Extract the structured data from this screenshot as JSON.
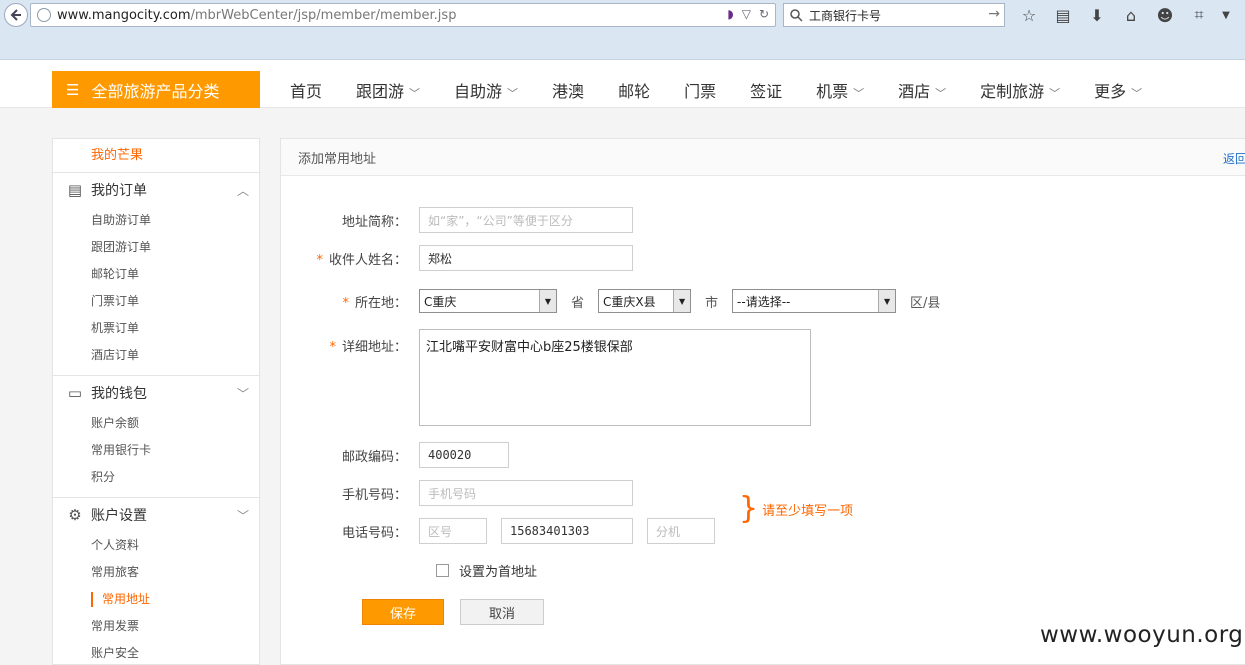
{
  "browser": {
    "url_domain": "www.mangocity.com",
    "url_path": "/mbrWebCenter/jsp/member/member.jsp",
    "search_text": "工商银行卡号"
  },
  "nav": {
    "category_label": "全部旅游产品分类",
    "items": [
      {
        "label": "首页",
        "dropdown": false
      },
      {
        "label": "跟团游",
        "dropdown": true
      },
      {
        "label": "自助游",
        "dropdown": true
      },
      {
        "label": "港澳",
        "dropdown": false
      },
      {
        "label": "邮轮",
        "dropdown": false
      },
      {
        "label": "门票",
        "dropdown": false
      },
      {
        "label": "签证",
        "dropdown": false
      },
      {
        "label": "机票",
        "dropdown": true
      },
      {
        "label": "酒店",
        "dropdown": true
      },
      {
        "label": "定制旅游",
        "dropdown": true
      },
      {
        "label": "更多",
        "dropdown": true
      }
    ]
  },
  "sidebar": {
    "top": "我的芒果",
    "groups": [
      {
        "title": "我的订单",
        "icon": "orders-icon",
        "expanded": true,
        "items": [
          "自助游订单",
          "跟团游订单",
          "邮轮订单",
          "门票订单",
          "机票订单",
          "酒店订单"
        ]
      },
      {
        "title": "我的钱包",
        "icon": "wallet-icon",
        "expanded": false,
        "items": [
          "账户余额",
          "常用银行卡",
          "积分"
        ]
      },
      {
        "title": "账户设置",
        "icon": "gear-icon",
        "expanded": false,
        "items": [
          "个人资料",
          "常用旅客",
          "常用地址",
          "常用发票",
          "账户安全"
        ]
      }
    ],
    "active_item": "常用地址"
  },
  "main": {
    "title": "添加常用地址",
    "back_label": "返回",
    "form": {
      "alias_label": "地址简称：",
      "alias_placeholder": "如“家”，“公司”等便于区分",
      "name_label": "收件人姓名：",
      "name_value": "郑松",
      "location_label": "所在地：",
      "province_value": "C重庆",
      "province_unit": "省",
      "city_value": "C重庆X县",
      "city_unit": "市",
      "district_value": "--请选择--",
      "district_unit": "区/县",
      "detail_label": "详细地址：",
      "detail_value": "江北嘴平安财富中心b座25楼银保部",
      "postcode_label": "邮政编码：",
      "postcode_value": "400020",
      "mobile_label": "手机号码：",
      "mobile_placeholder": "手机号码",
      "phone_label": "电话号码：",
      "area_placeholder": "区号",
      "phone_value": "15683401303",
      "ext_placeholder": "分机",
      "hint": "请至少填写一项",
      "default_label": "设置为首地址",
      "default_checked": false,
      "save_label": "保存",
      "cancel_label": "取消"
    }
  },
  "watermark": "www.wooyun.org"
}
